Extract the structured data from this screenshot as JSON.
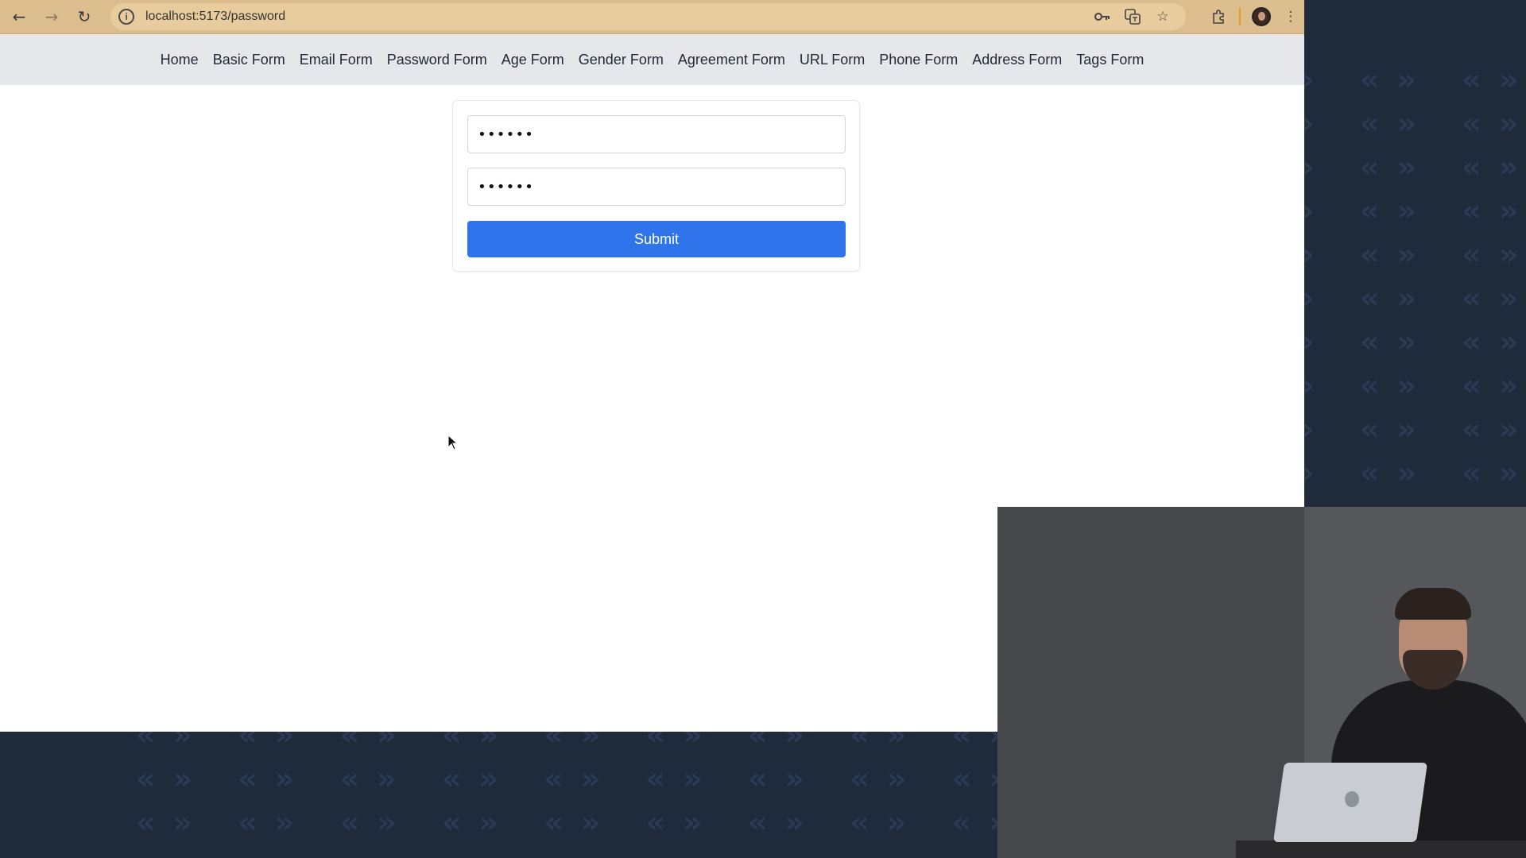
{
  "browser": {
    "url": "localhost:5173/password",
    "icons": [
      "back-icon",
      "forward-icon",
      "reload-icon",
      "info-icon",
      "key-icon",
      "translate-icon",
      "star-icon",
      "extensions-icon",
      "profile-avatar",
      "menu-dots-icon"
    ]
  },
  "nav": {
    "items": [
      {
        "label": "Home"
      },
      {
        "label": "Basic Form"
      },
      {
        "label": "Email Form"
      },
      {
        "label": "Password Form"
      },
      {
        "label": "Age Form"
      },
      {
        "label": "Gender Form"
      },
      {
        "label": "Agreement Form"
      },
      {
        "label": "URL Form"
      },
      {
        "label": "Phone Form"
      },
      {
        "label": "Address Form"
      },
      {
        "label": "Tags Form"
      }
    ]
  },
  "form": {
    "password_value": "••••••",
    "confirm_value": "••••••",
    "submit_label": "Submit"
  },
  "colors": {
    "toolbar": "#dcbd8e",
    "nav_bg": "#e5e7eb",
    "submit_bg": "#2f74eb",
    "page_bg": "#1f2a3a"
  }
}
